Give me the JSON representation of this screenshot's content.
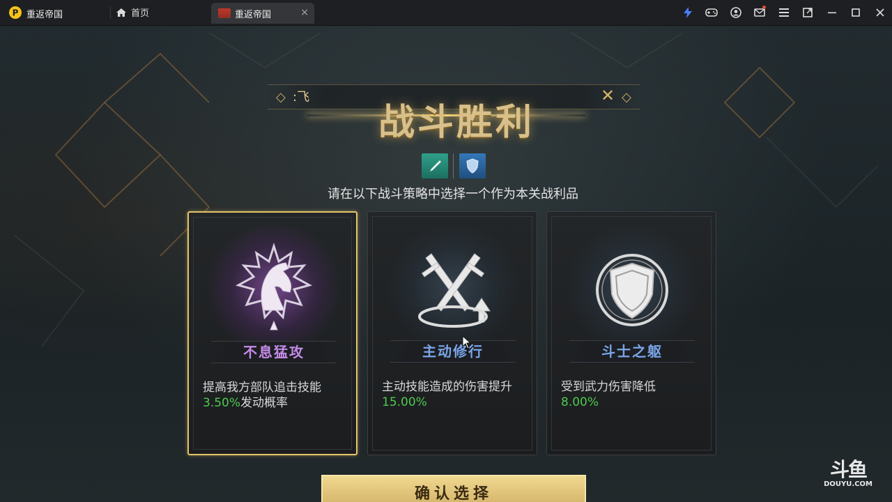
{
  "launcher": {
    "app_name": "重返帝国",
    "home_tab": "首页",
    "game_tab": "重返帝国",
    "tab_close": "×"
  },
  "game": {
    "title": "战斗胜利",
    "header_text": ":飞",
    "instruction": "请在以下战斗策略中选择一个作为本关战利品",
    "cards": [
      {
        "name": "不息猛攻",
        "name_color": "#c58be8",
        "desc_before": "提高我方部队追击技能",
        "value": "3.50%",
        "desc_after": "发动概率",
        "selected": true,
        "icon": "horse-icon"
      },
      {
        "name": "主动修行",
        "name_color": "#7aa6e8",
        "desc_before": "主动技能造成的伤害提升",
        "value": "15.00%",
        "desc_after": "",
        "selected": false,
        "icon": "crossed-swords-icon"
      },
      {
        "name": "斗士之躯",
        "name_color": "#7aa6e8",
        "desc_before": "受到武力伤害降低",
        "value": "8.00%",
        "desc_after": "",
        "selected": false,
        "icon": "shield-icon"
      }
    ],
    "confirm_label": "确认选择"
  },
  "watermark": {
    "big": "斗鱼",
    "small": "DOUYU.COM"
  },
  "colors": {
    "gold": "#e5c46a",
    "value_green": "#4fc94f",
    "topbar": "#1e1f22"
  }
}
